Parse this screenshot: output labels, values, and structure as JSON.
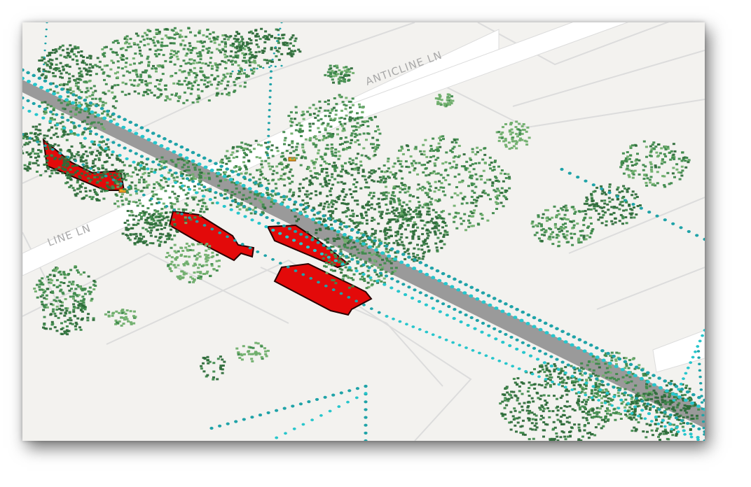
{
  "map": {
    "street_labels": {
      "anticline_upper": "ANTICLINE LN",
      "anticline_lower": "LINE LN"
    },
    "colors": {
      "background": "#f3f2ef",
      "parcel_stroke": "#dcdcdc",
      "road_surface": "#ffffff",
      "main_road": "#9a9a9a",
      "building_fill": "#e30a0a",
      "building_stroke": "#2a0000",
      "tree_dark": "#2e6b3a",
      "tree_mid": "#3f8a4c",
      "tree_light": "#6fae6c",
      "powerline": "#1fa3a8",
      "powerline_light": "#27c6cc",
      "marker": "#f0a020"
    },
    "layers": [
      "parcels",
      "roads",
      "buildings",
      "vegetation-point-cloud",
      "powerline-point-cloud"
    ]
  }
}
